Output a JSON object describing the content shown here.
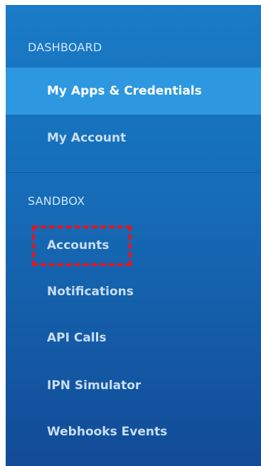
{
  "sidebar": {
    "dashboard_header": "DASHBOARD",
    "dashboard_items": [
      {
        "label": "My Apps & Credentials",
        "active": true
      },
      {
        "label": "My Account",
        "active": false
      }
    ],
    "sandbox_header": "SANDBOX",
    "sandbox_items": [
      {
        "label": "Accounts",
        "highlighted": true
      },
      {
        "label": "Notifications"
      },
      {
        "label": "API Calls"
      },
      {
        "label": "IPN Simulator"
      },
      {
        "label": "Webhooks Events"
      }
    ]
  },
  "colors": {
    "sidebar_top": "#1a7bc7",
    "sidebar_bottom": "#124b97",
    "active_item_bg": "#2d98e0",
    "highlight_border": "#e8141f"
  }
}
